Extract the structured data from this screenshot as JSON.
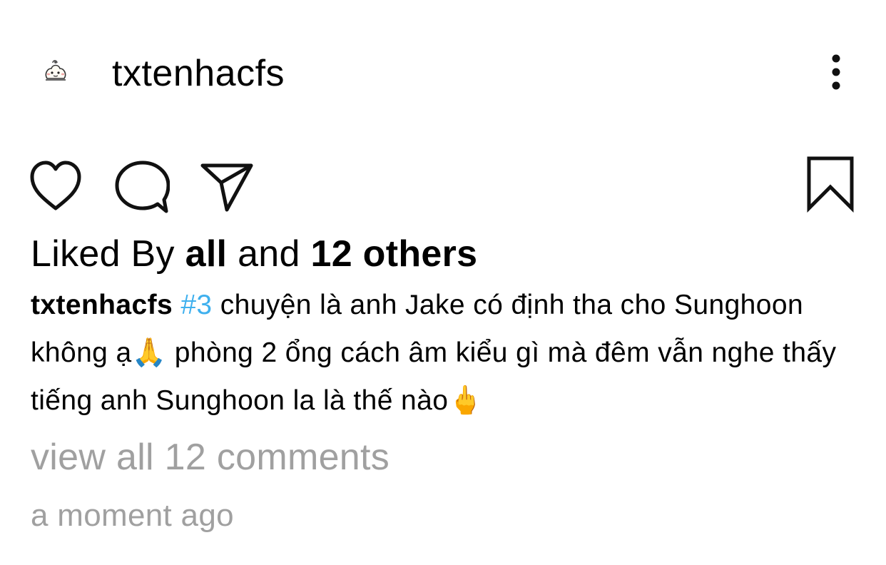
{
  "post": {
    "username": "txtenhacfs",
    "avatar_icon": "cartoon-avatar-icon",
    "more_icon": "more-vertical-icon"
  },
  "actions": {
    "like_icon": "heart-icon",
    "comment_icon": "comment-bubble-icon",
    "share_icon": "paper-plane-icon",
    "save_icon": "bookmark-icon"
  },
  "likes": {
    "prefix": "Liked By",
    "first_liker": "all",
    "conjunction": "and",
    "others": "12 others"
  },
  "caption": {
    "username": "txtenhacfs",
    "hashtag": "#3",
    "text_part1": " chuyện là anh Jake có định tha cho Sunghoon không ạ",
    "emoji1": "🙏",
    "text_part2": "  phòng 2 ổng cách âm kiểu gì mà đêm vẫn nghe thấy tiếng anh Sunghoon la là thế nào",
    "emoji2": "🖕"
  },
  "comments": {
    "view_all_label": "view all 12 comments"
  },
  "timestamp": "a moment ago",
  "colors": {
    "hashtag": "#3fb0ee",
    "muted_text": "#a0a0a0",
    "text": "#000000",
    "background": "#ffffff"
  }
}
